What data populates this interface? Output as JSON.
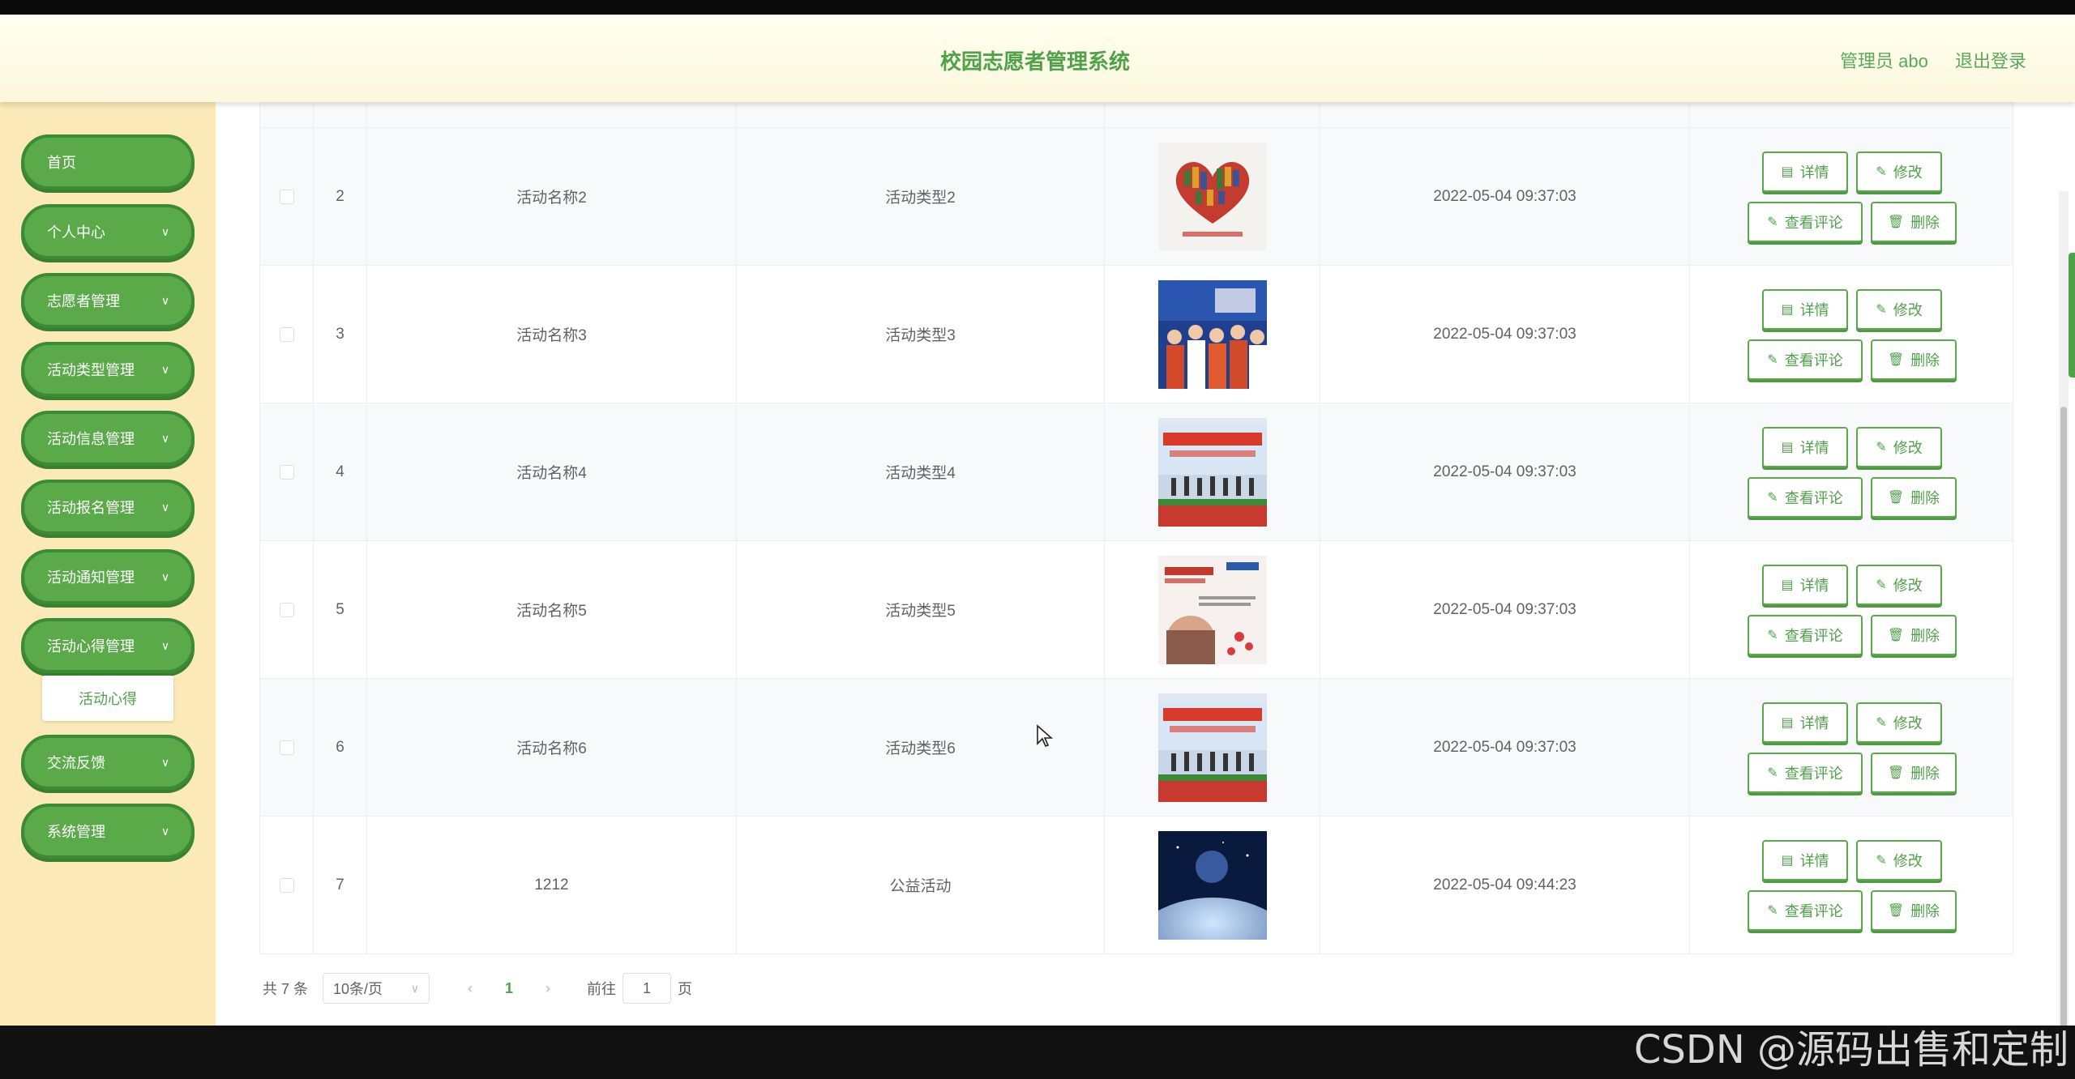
{
  "header": {
    "title": "校园志愿者管理系统",
    "user": "管理员 abo",
    "logout": "退出登录"
  },
  "sidebar": {
    "items": [
      {
        "label": "首页",
        "chevron": ""
      },
      {
        "label": "个人中心",
        "chevron": "⌄"
      },
      {
        "label": "志愿者管理",
        "chevron": "⌄"
      },
      {
        "label": "活动类型管理",
        "chevron": "⌄"
      },
      {
        "label": "活动信息管理",
        "chevron": "⌄"
      },
      {
        "label": "活动报名管理",
        "chevron": "⌄"
      },
      {
        "label": "活动通知管理",
        "chevron": "⌄"
      },
      {
        "label": "活动心得管理",
        "chevron": "⌄"
      },
      {
        "label": "交流反馈",
        "chevron": "⌄"
      },
      {
        "label": "系统管理",
        "chevron": "⌄"
      }
    ],
    "subitem": "活动心得"
  },
  "table": {
    "rows": [
      {
        "idx": "2",
        "name": "活动名称2",
        "type": "活动类型2",
        "time": "2022-05-04 09:37:03",
        "image": "heart"
      },
      {
        "idx": "3",
        "name": "活动名称3",
        "type": "活动类型3",
        "time": "2022-05-04 09:37:03",
        "image": "crowd"
      },
      {
        "idx": "4",
        "name": "活动名称4",
        "type": "活动类型4",
        "time": "2022-05-04 09:37:03",
        "image": "stage"
      },
      {
        "idx": "5",
        "name": "活动名称5",
        "type": "活动类型5",
        "time": "2022-05-04 09:37:03",
        "image": "poster"
      },
      {
        "idx": "6",
        "name": "活动名称6",
        "type": "活动类型6",
        "time": "2022-05-04 09:37:03",
        "image": "stage"
      },
      {
        "idx": "7",
        "name": "1212",
        "type": "公益活动",
        "time": "2022-05-04 09:44:23",
        "image": "space"
      }
    ],
    "actions": {
      "detail": "详情",
      "edit": "修改",
      "comments": "查看评论",
      "delete": "删除"
    }
  },
  "pagination": {
    "total": "共 7 条",
    "page_size": "10条/页",
    "current": "1",
    "goto_prefix": "前往",
    "goto_value": "1",
    "goto_suffix": "页"
  },
  "watermark": "CSDN @源码出售和定制",
  "colors": {
    "accent": "#5aaa4a",
    "sidebar_bg": "#fbe9b7",
    "header_bg": "#fdfbe6"
  }
}
